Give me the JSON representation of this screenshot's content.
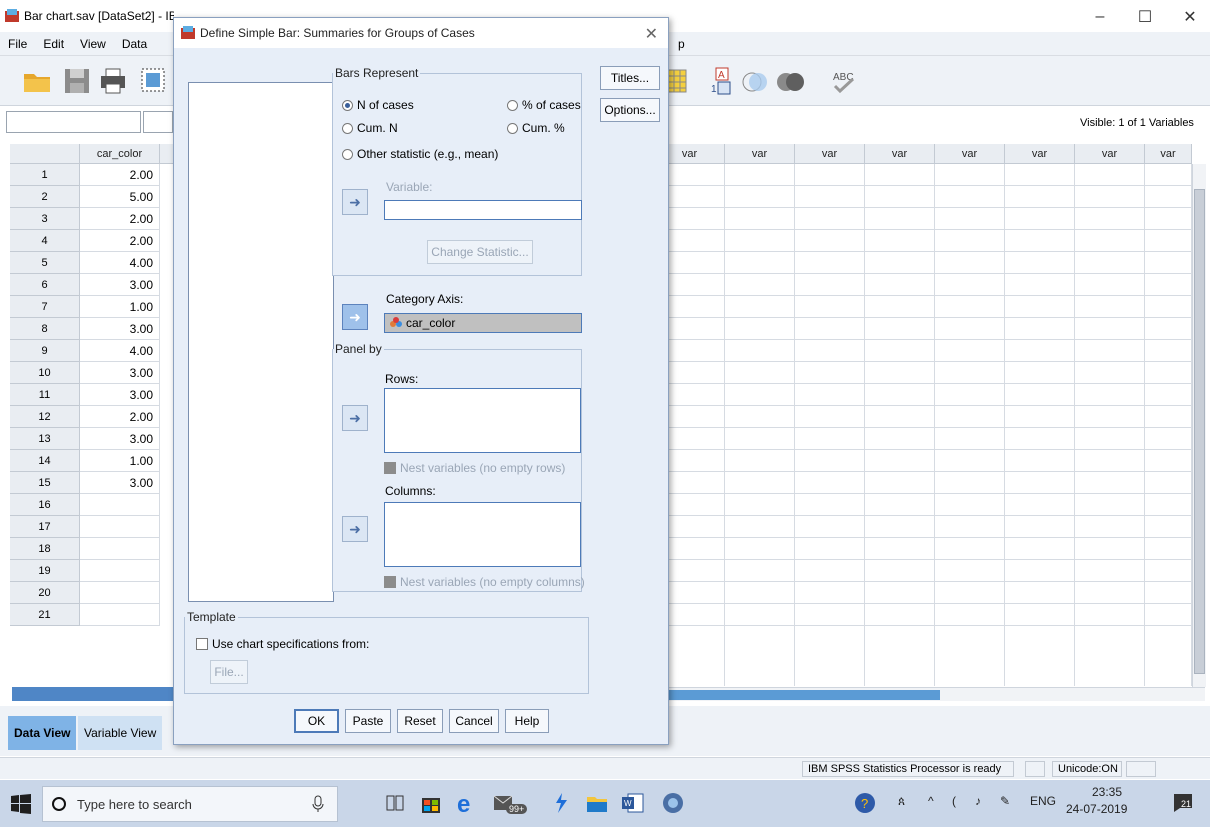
{
  "window": {
    "title": "Bar chart.sav [DataSet2] - IBM SPSS Statistics Data Editor",
    "controls": [
      "–",
      "☐",
      "✕"
    ]
  },
  "menu": [
    "File",
    "Edit",
    "View",
    "Data"
  ],
  "menu_hidden_tail": "p",
  "filter": {
    "visible_label": "Visible: 1 of 1 Variables"
  },
  "grid": {
    "column": "car_color",
    "var_label": "var",
    "rows": [
      {
        "n": "1",
        "v": "2.00"
      },
      {
        "n": "2",
        "v": "5.00"
      },
      {
        "n": "3",
        "v": "2.00"
      },
      {
        "n": "4",
        "v": "2.00"
      },
      {
        "n": "5",
        "v": "4.00"
      },
      {
        "n": "6",
        "v": "3.00"
      },
      {
        "n": "7",
        "v": "1.00"
      },
      {
        "n": "8",
        "v": "3.00"
      },
      {
        "n": "9",
        "v": "4.00"
      },
      {
        "n": "10",
        "v": "3.00"
      },
      {
        "n": "11",
        "v": "3.00"
      },
      {
        "n": "12",
        "v": "2.00"
      },
      {
        "n": "13",
        "v": "3.00"
      },
      {
        "n": "14",
        "v": "1.00"
      },
      {
        "n": "15",
        "v": "3.00"
      },
      {
        "n": "16",
        "v": ""
      },
      {
        "n": "17",
        "v": ""
      },
      {
        "n": "18",
        "v": ""
      },
      {
        "n": "19",
        "v": ""
      },
      {
        "n": "20",
        "v": ""
      },
      {
        "n": "21",
        "v": ""
      }
    ]
  },
  "tabs": {
    "data_view": "Data View",
    "variable_view": "Variable View"
  },
  "status": {
    "processor": "IBM SPSS Statistics Processor is ready",
    "unicode": "Unicode:ON"
  },
  "dialog": {
    "title": "Define Simple Bar: Summaries for Groups of Cases",
    "bars_represent": {
      "legend": "Bars Represent",
      "n_cases": "N of cases",
      "pct_cases": "% of cases",
      "cum_n": "Cum. N",
      "cum_pct": "Cum. %",
      "other": "Other statistic (e.g., mean)",
      "variable_label": "Variable:",
      "change_stat": "Change Statistic..."
    },
    "category_axis": {
      "label": "Category Axis:",
      "value": "car_color"
    },
    "panel_by": {
      "legend": "Panel by",
      "rows": "Rows:",
      "nest_rows": "Nest variables (no empty rows)",
      "columns": "Columns:",
      "nest_cols": "Nest variables (no empty columns)"
    },
    "template": {
      "legend": "Template",
      "use_spec": "Use chart specifications from:",
      "file": "File..."
    },
    "side_buttons": {
      "titles": "Titles...",
      "options": "Options..."
    },
    "buttons": {
      "ok": "OK",
      "paste": "Paste",
      "reset": "Reset",
      "cancel": "Cancel",
      "help": "Help"
    }
  },
  "taskbar": {
    "search_placeholder": "Type here to search",
    "badge": "99+",
    "lang": "ENG",
    "time": "23:35",
    "date": "24-07-2019",
    "notif": "21"
  }
}
